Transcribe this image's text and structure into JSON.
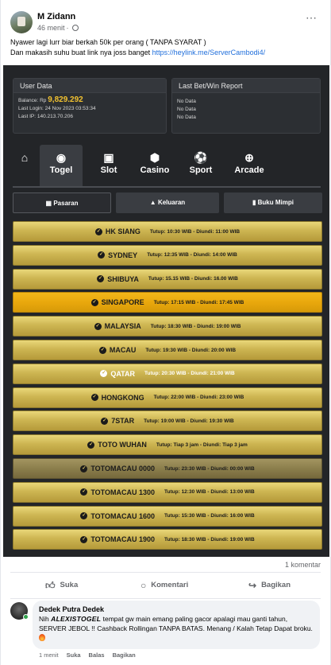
{
  "post": {
    "author": "M Zidann",
    "time": "46 menit",
    "more_icon": "⋯",
    "text_line1": "Nyawer lagi lurr biar berkah 50k per orang ( TANPA SYARAT )",
    "text_line2_prefix": "Dan makasih suhu buat link nya joss banget ",
    "link": "https://heylink.me/ServerCambodi4/"
  },
  "site": {
    "user_panel": {
      "title": "User Data",
      "balance_label": "Balance: Rp",
      "balance_value": "9,829.292",
      "last_login": "Last Login: 24 Nov 2023 03:53:34",
      "last_ip": "Last IP: 140.213.70.206"
    },
    "bet_panel": {
      "title": "Last Bet/Win Report",
      "rows": [
        "No Data",
        "No Data",
        "No Data"
      ]
    },
    "nav": [
      {
        "label": "",
        "icon": "home-icon",
        "glyph": "⌂"
      },
      {
        "label": "Togel",
        "icon": "lottery-ball-icon",
        "glyph": "◉"
      },
      {
        "label": "Slot",
        "icon": "slot-machine-icon",
        "glyph": "▣"
      },
      {
        "label": "Casino",
        "icon": "dice-icon",
        "glyph": "⬢"
      },
      {
        "label": "Sport",
        "icon": "soccer-ball-icon",
        "glyph": "⚽"
      },
      {
        "label": "Arcade",
        "icon": "crosshair-icon",
        "glyph": "⊕"
      }
    ],
    "tabs": [
      {
        "label": "Pasaran",
        "icon": "table-icon",
        "glyph": "▦"
      },
      {
        "label": "Keluaran",
        "icon": "bell-icon",
        "glyph": "▲"
      },
      {
        "label": "Buku Mimpi",
        "icon": "book-icon",
        "glyph": "▮"
      }
    ],
    "markets": [
      {
        "name": "HK SIANG",
        "time": "Tutup: 10:30 WIB - Diundi: 11:00 WIB",
        "style": "normal"
      },
      {
        "name": "SYDNEY",
        "time": "Tutup: 12:35 WIB - Diundi: 14:00 WIB",
        "style": "normal"
      },
      {
        "name": "SHIBUYA",
        "time": "Tutup: 15.15 WIB - Diundi: 16.00 WIB",
        "style": "normal"
      },
      {
        "name": "SINGAPORE",
        "time": "Tutup: 17:15 WIB - Diundi: 17:45 WIB",
        "style": "active"
      },
      {
        "name": "MALAYSIA",
        "time": "Tutup: 18:30 WIB - Diundi: 19:00 WIB",
        "style": "normal"
      },
      {
        "name": "MACAU",
        "time": "Tutup: 19:30 WIB - Diundi: 20:00 WIB",
        "style": "normal"
      },
      {
        "name": "QATAR",
        "time": "Tutup: 20:30 WIB - Diundi: 21:00 WIB",
        "style": "qatar"
      },
      {
        "name": "HONGKONG",
        "time": "Tutup: 22:00 WIB - Diundi: 23:00 WIB",
        "style": "normal"
      },
      {
        "name": "7STAR",
        "time": "Tutup: 19:00 WIB - Diundi: 19:30 WIB",
        "style": "normal"
      },
      {
        "name": "TOTO WUHAN",
        "time": "Tutup: Tiap 3 jam - Diundi: Tiap 3 jam",
        "style": "normal"
      },
      {
        "name": "TOTOMACAU 0000",
        "time": "Tutup: 23:30 WIB - Diundi: 00:00 WIB",
        "style": "dim"
      },
      {
        "name": "TOTOMACAU 1300",
        "time": "Tutup: 12:30 WIB - Diundi: 13:00 WIB",
        "style": "normal"
      },
      {
        "name": "TOTOMACAU 1600",
        "time": "Tutup: 15:30 WIB - Diundi: 16:00 WIB",
        "style": "normal"
      },
      {
        "name": "TOTOMACAU 1900",
        "time": "Tutup: 18:30 WIB - Diundi: 19:00 WIB",
        "style": "normal"
      }
    ]
  },
  "footer": {
    "comment_count": "1 komentar",
    "like": "Suka",
    "comment": "Komentari",
    "share": "Bagikan"
  },
  "comment": {
    "author": "Dedek Putra Dedek",
    "text_prefix": "Nih ",
    "brand": "ALEXISTOGEL",
    "text_suffix": " tempat gw main emang paling gacor apalagi mau ganti tahun, SERVER JEBOL !! Cashback Rollingan TANPA BATAS. Menang / Kalah Tetap Dapat broku. ",
    "time": "1 menit",
    "like": "Suka",
    "reply": "Balas",
    "share": "Bagikan"
  }
}
